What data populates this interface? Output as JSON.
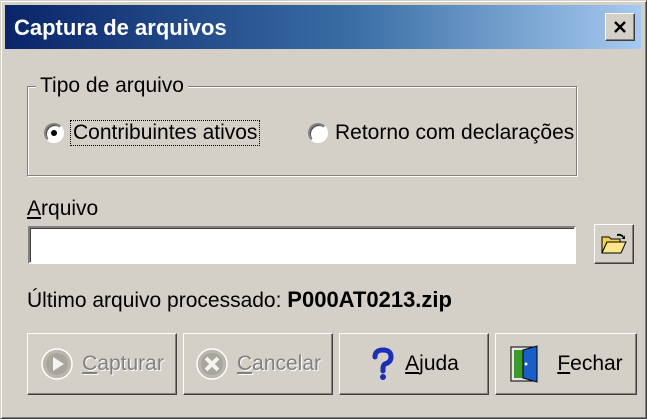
{
  "window": {
    "title": "Captura de arquivos",
    "close_glyph": "✕"
  },
  "file_type_group": {
    "legend": "Tipo de arquivo",
    "options": [
      {
        "label": "Contribuintes ativos",
        "selected": true
      },
      {
        "label": "Retorno com declarações",
        "selected": false
      }
    ]
  },
  "file_field": {
    "label_mnemonic": "A",
    "label_rest": "rquivo",
    "value": "",
    "placeholder": ""
  },
  "last_processed": {
    "label": "Último arquivo processado:",
    "value": "P000AT0213.zip"
  },
  "buttons": {
    "capture": {
      "mnemonic": "C",
      "rest": "apturar",
      "enabled": false,
      "icon": "play-icon"
    },
    "cancel": {
      "mnemonic": "C",
      "rest": "ancelar",
      "enabled": false,
      "icon": "cancel-x-icon"
    },
    "help": {
      "mnemonic": "A",
      "rest": "juda",
      "enabled": true,
      "icon": "question-mark-icon"
    },
    "close": {
      "mnemonic": "F",
      "rest": "echar",
      "enabled": true,
      "icon": "exit-door-icon"
    }
  },
  "colors": {
    "dialog_face": "#d4d0c8",
    "titlebar_start": "#0a246a",
    "titlebar_end": "#a6caf0",
    "disabled_text": "#808080"
  }
}
